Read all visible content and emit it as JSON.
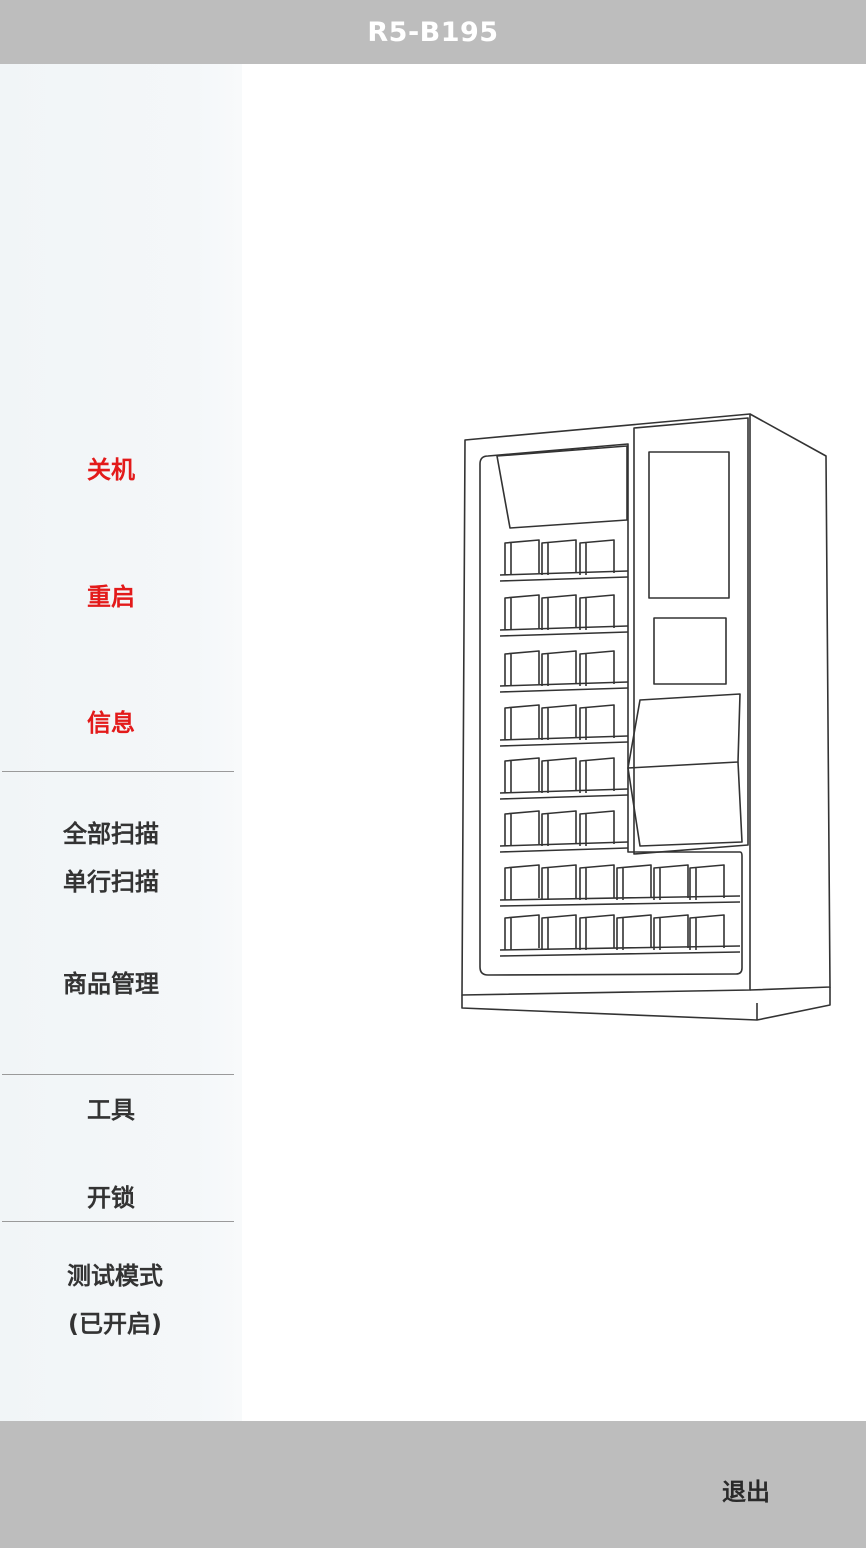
{
  "header": {
    "title": "R5-B195"
  },
  "sidebar": {
    "power_items": [
      {
        "label": "关机"
      },
      {
        "label": "重启"
      },
      {
        "label": "信息"
      }
    ],
    "scan_all": "全部扫描",
    "scan_row": "单行扫描",
    "product_management": "商品管理",
    "tools": "工具",
    "unlock": "开锁",
    "test_mode_line1": "测试模式",
    "test_mode_line2": "(已开启)"
  },
  "footer": {
    "exit_label": "退出"
  },
  "colors": {
    "bar_gray": "#bdbdbd",
    "accent_red": "#e31a1a",
    "menu_text": "#333333"
  },
  "illustration": {
    "icon": "vending-machine-icon"
  }
}
